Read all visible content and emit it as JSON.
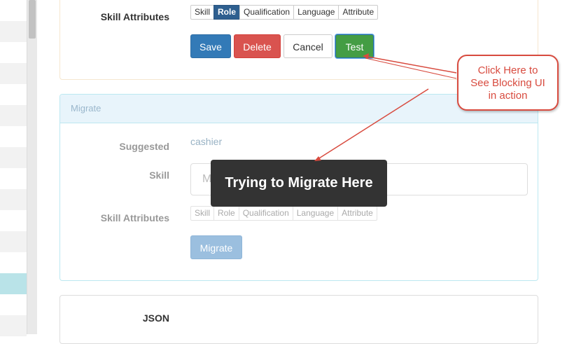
{
  "top_panel": {
    "skill_attributes_label": "Skill Attributes",
    "attributes": [
      "Skill",
      "Role",
      "Qualification",
      "Language",
      "Attribute"
    ],
    "active_attribute": "Role",
    "buttons": {
      "save": "Save",
      "delete": "Delete",
      "cancel": "Cancel",
      "test": "Test"
    }
  },
  "migrate_panel": {
    "heading": "Migrate",
    "suggested_label": "Suggested",
    "suggested_value": "cashier",
    "skill_label": "Skill",
    "skill_input_text": "M",
    "skill_attributes_label": "Skill Attributes",
    "attributes": [
      "Skill",
      "Role",
      "Qualification",
      "Language",
      "Attribute"
    ],
    "migrate_button": "Migrate"
  },
  "json_panel": {
    "label": "JSON"
  },
  "blocking_message": "Trying to Migrate Here",
  "annotation": {
    "line1": "Click Here to",
    "line2": "See Blocking UI",
    "line3": "in action",
    "color": "#d84b3f"
  },
  "colors": {
    "primary": "#337ab7",
    "danger": "#d9534f",
    "success": "#449d44",
    "info_border": "#bce8f1"
  }
}
